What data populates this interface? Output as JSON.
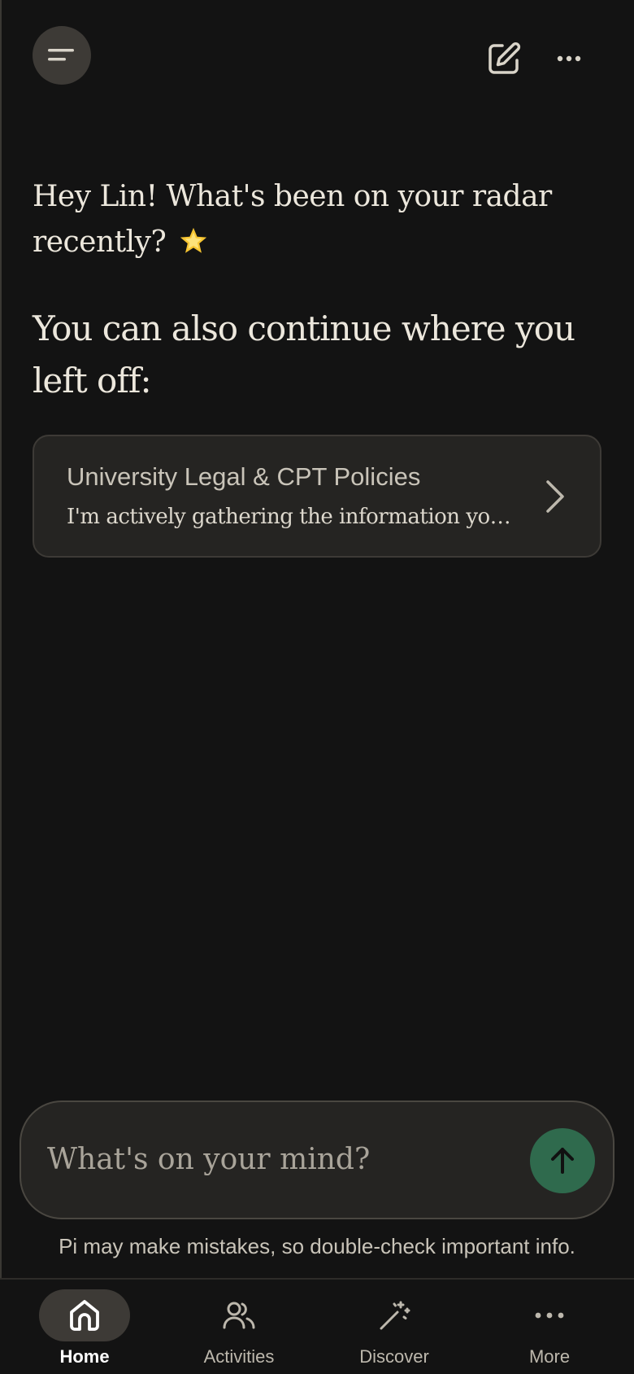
{
  "header": {
    "menu_icon": "menu-lines-icon",
    "compose_icon": "edit-pencil-icon",
    "more_icon": "ellipsis-icon"
  },
  "greeting": {
    "text": "Hey Lin! What's been on your radar recently?",
    "emoji": "🌟"
  },
  "continue_prompt": "You can also continue where you left off:",
  "recent_conversation": {
    "title": "University Legal & CPT Policies",
    "snippet": "I'm actively gathering the information you ...",
    "icon": "chevron-right-icon"
  },
  "composer": {
    "placeholder": "What's on your mind?",
    "value": "",
    "send_icon": "arrow-up-icon",
    "send_color": "#2f6a4d"
  },
  "disclaimer": "Pi may make mistakes, so double-check important info.",
  "bottom_nav": {
    "items": [
      {
        "label": "Home",
        "icon": "home-icon",
        "active": true
      },
      {
        "label": "Activities",
        "icon": "people-icon",
        "active": false
      },
      {
        "label": "Discover",
        "icon": "magic-wand-icon",
        "active": false
      },
      {
        "label": "More",
        "icon": "ellipsis-icon",
        "active": false
      }
    ]
  },
  "colors": {
    "background": "#131313",
    "card": "#252422",
    "accent": "#2f6a4d"
  }
}
